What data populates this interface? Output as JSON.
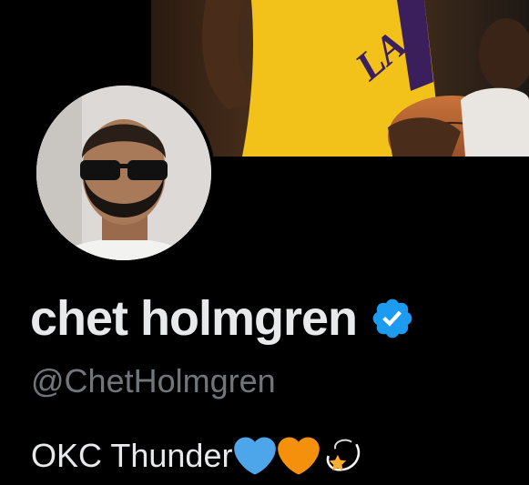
{
  "profile": {
    "display_name": "chet holmgren",
    "handle": "@ChetHolmgren",
    "bio_text": "OKC Thunder",
    "verified": true,
    "bio_emojis": [
      "blue-heart",
      "orange-heart",
      "dizzy-star"
    ],
    "banner_jersey_text": "LA"
  },
  "colors": {
    "background": "#000000",
    "name": "#e7e9ea",
    "handle": "#71767b",
    "verified_badge": "#1d9bf0",
    "blue_heart": "#4ea6ea",
    "orange_heart": "#f4900c"
  }
}
